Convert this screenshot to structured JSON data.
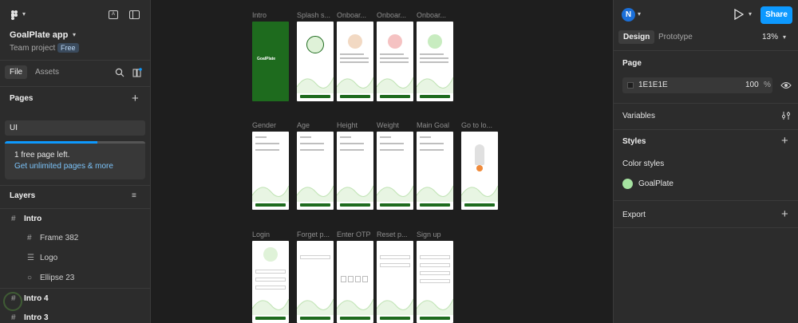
{
  "left_panel": {
    "project_name": "GoalPlate app",
    "team_label": "Team project",
    "plan_badge": "Free",
    "tab_file": "File",
    "tab_assets": "Assets",
    "pages_title": "Pages",
    "current_page": "UI",
    "free_page_notice": "1 free page left.",
    "upgrade_link": "Get unlimited pages & more",
    "layers_title": "Layers",
    "layers": [
      {
        "name": "Intro",
        "indent": 0,
        "icon": "frame-icon"
      },
      {
        "name": "Frame 382",
        "indent": 1,
        "icon": "frame-icon"
      },
      {
        "name": "Logo",
        "indent": 1,
        "icon": "text-icon"
      },
      {
        "name": "Ellipse 23",
        "indent": 1,
        "icon": "ellipse-icon"
      },
      {
        "name": "Intro 4",
        "indent": 0,
        "icon": "frame-icon"
      },
      {
        "name": "Intro 3",
        "indent": 0,
        "icon": "frame-icon"
      }
    ]
  },
  "canvas": {
    "row1_labels": [
      "Intro",
      "Splash s...",
      "Onboar...",
      "Onboar...",
      "Onboar..."
    ],
    "row2_labels": [
      "Gender",
      "Age",
      "Height",
      "Weight",
      "Main Goal",
      "Go to lo..."
    ],
    "row3_labels": [
      "Login",
      "Forget p...",
      "Enter OTP",
      "Reset p...",
      "Sign up"
    ],
    "intro_logo_text": "GoalPlate",
    "brand_green": "#1e6b1e"
  },
  "right_panel": {
    "avatar_letter": "N",
    "share_label": "Share",
    "tab_design": "Design",
    "tab_prototype": "Prototype",
    "zoom": "13%",
    "page_section": "Page",
    "page_color": "1E1E1E",
    "page_opacity": "100",
    "percent_sign": "%",
    "variables_label": "Variables",
    "styles_label": "Styles",
    "color_styles_label": "Color styles",
    "color_style_name": "GoalPlate",
    "color_style_hex": "#a6e3a1",
    "export_label": "Export",
    "accent": "#0d99ff"
  }
}
